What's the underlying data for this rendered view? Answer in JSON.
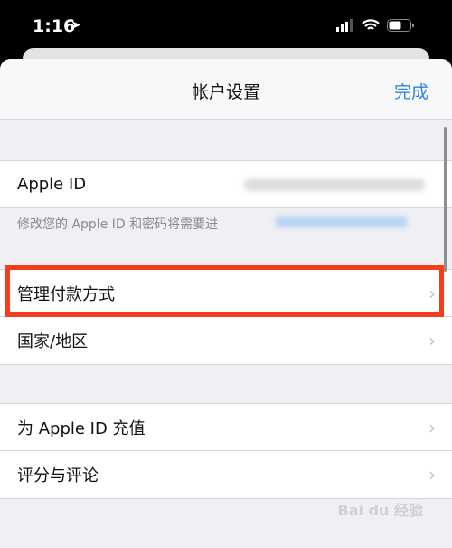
{
  "status_bar": {
    "time": "1:16",
    "icons": [
      "location-icon",
      "signal-icon",
      "wifi-icon",
      "battery-icon"
    ]
  },
  "nav": {
    "title": "帐户设置",
    "done": "完成"
  },
  "apple_id": {
    "label": "Apple ID",
    "footnote": "修改您的 Apple ID 和密码将需要进"
  },
  "rows": [
    {
      "label": "管理付款方式"
    },
    {
      "label": "国家/地区"
    },
    {
      "label": "为 Apple ID 充值"
    },
    {
      "label": "评分与评论"
    }
  ],
  "watermark": "Bai du 经验",
  "colors": {
    "accent": "#2e86de",
    "highlight": "#f53c1b"
  }
}
